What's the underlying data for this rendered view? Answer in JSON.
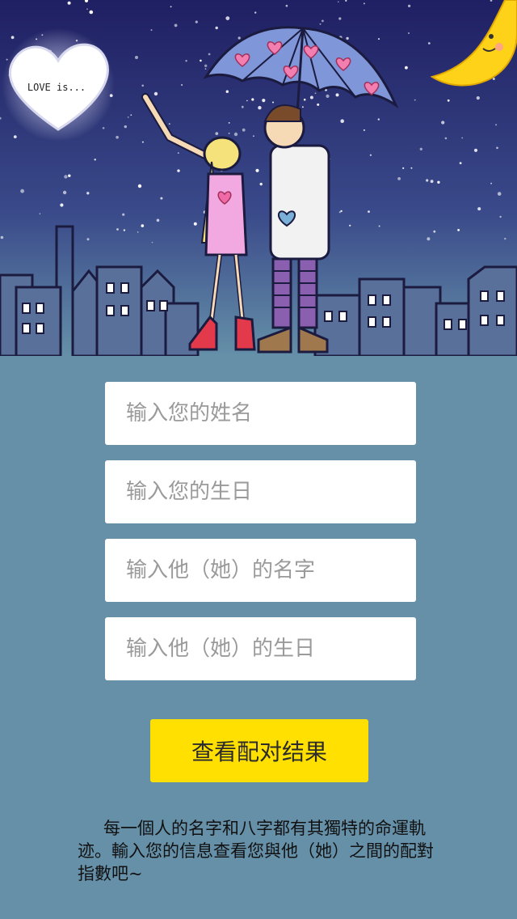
{
  "hero": {
    "sign_text": "LOVE is..."
  },
  "form": {
    "name_placeholder": "输入您的姓名",
    "birthday_placeholder": "输入您的生日",
    "partner_name_placeholder": "输入他（她）的名字",
    "partner_birthday_placeholder": "输入他（她）的生日"
  },
  "submit_label": "查看配对结果",
  "description": "每一個人的名字和八字都有其獨特的命運軌迹。輸入您的信息查看您與他（她）之間的配對指數吧~",
  "colors": {
    "sky": "#2a2a6e",
    "ground": "#6590a8",
    "button": "#ffe000",
    "field": "#ffffff"
  }
}
